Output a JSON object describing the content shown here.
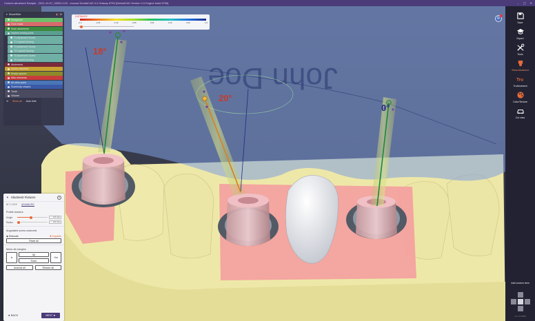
{
  "titlebar": {
    "title": "Custom abutment Sample - 2021-10-07_00000-CGI - exocad DentalCAD 3.0 Galway 8795 [DentalCAD Version 3.0 Engine build 8795]",
    "min": "–",
    "max": "▢",
    "close": "✕"
  },
  "scene_tree": {
    "title": "Show/Hide",
    "items": [
      {
        "label": "Antagonist",
        "color": "#6cc06c",
        "sub": false
      },
      {
        "label": "Gum mask",
        "color": "#d86a6a",
        "sub": false
      },
      {
        "label": "Scan abutments",
        "color": "#3c8a3c",
        "sub": false
      },
      {
        "label": "Implant analog parts",
        "color": "#5aa090",
        "sub": false
      },
      {
        "label": "T1 Abutment Screw",
        "color": "#6fb0a4",
        "sub": true
      },
      {
        "label": "T1 Implant Analog",
        "color": "#6fb0a4",
        "sub": true
      },
      {
        "label": "T4 Abutment Screw",
        "color": "#6fb0a4",
        "sub": true
      },
      {
        "label": "T4 Implant Analog",
        "color": "#6fb0a4",
        "sub": true
      },
      {
        "label": "T6 Abutment Screw",
        "color": "#6fb0a4",
        "sub": true
      },
      {
        "label": "T6 Implant Analog",
        "color": "#6fb0a4",
        "sub": true
      },
      {
        "label": "Abutments",
        "color": "#7a2a3a",
        "sub": false
      },
      {
        "label": "Screw channels",
        "color": "#c9a230",
        "sub": false
      },
      {
        "label": "Empty spaces",
        "color": "#8a8a2a",
        "sub": false
      },
      {
        "label": "Misc elements",
        "color": "#c83c3c",
        "sub": false
      },
      {
        "label": "All other parts",
        "color": "#4a76b8",
        "sub": false
      },
      {
        "label": "Scanbody shapes",
        "color": "#3a5aa8",
        "sub": false
      },
      {
        "label": "Tooth",
        "color": "#4a4a60",
        "sub": false
      },
      {
        "label": "Volume",
        "color": "#4a4a60",
        "sub": false
      }
    ],
    "show_all": "Show all",
    "auto_hide": "Auto hide"
  },
  "colorbar": {
    "label": "DISTANCE",
    "ticks": [
      "-0.3",
      "-0.25",
      "-0.15",
      "-0.05",
      "0.05",
      "0.15",
      "0.25",
      "0.3"
    ]
  },
  "abutment_panel": {
    "title": "Abutment Fixtures",
    "help": "?",
    "tabs": [
      "BIT CORE",
      "ADVANCED"
    ],
    "profile_title": "Profile borders",
    "height_label": "Height",
    "height_value": "0.0 mm",
    "radius_label": "Radius",
    "radius_value": "0.0 mm",
    "channels_title": "Angulated screw channels",
    "disable_label": "Dislocate",
    "angulate_label": "Angulate",
    "reset_label": "Reset all",
    "margins_title": "Move all margins",
    "in_label": "In",
    "up_label": "Up",
    "down_label": "Down",
    "out_label": "Out",
    "undo_label": "Undo/ck all",
    "restore_label": "Restore all",
    "back_label": "◄ BACK",
    "next_label": "NEXT ►",
    "height_fraction": 0.45,
    "radius_fraction": 0.05
  },
  "viewport": {
    "angle_1": "18°",
    "angle_2": "20°",
    "angle_3": "0°",
    "watermark": "John Doe"
  },
  "sidebar": {
    "items": [
      {
        "label": "Save",
        "icon": "save-icon"
      },
      {
        "label": "Expert",
        "icon": "graduation-cap-icon"
      },
      {
        "label": "Tools",
        "icon": "tools-icon"
      },
      {
        "label": "Show Abutment",
        "icon": "abutment-icon"
      },
      {
        "label": "TruAbutment",
        "icon": "tru-logo-icon"
      },
      {
        "label": "Color/Texture",
        "icon": "palette-icon"
      },
      {
        "label": "Cut view",
        "icon": "car-icon"
      }
    ],
    "add_custom_view": "Add custom view",
    "version": "v1.3.179948"
  },
  "avatar": {
    "initial": "R"
  },
  "colors": {
    "accent": "#4b3b79",
    "orange": "#e46a3a",
    "gum": "#f29a9a",
    "model": "#eee8a8"
  }
}
